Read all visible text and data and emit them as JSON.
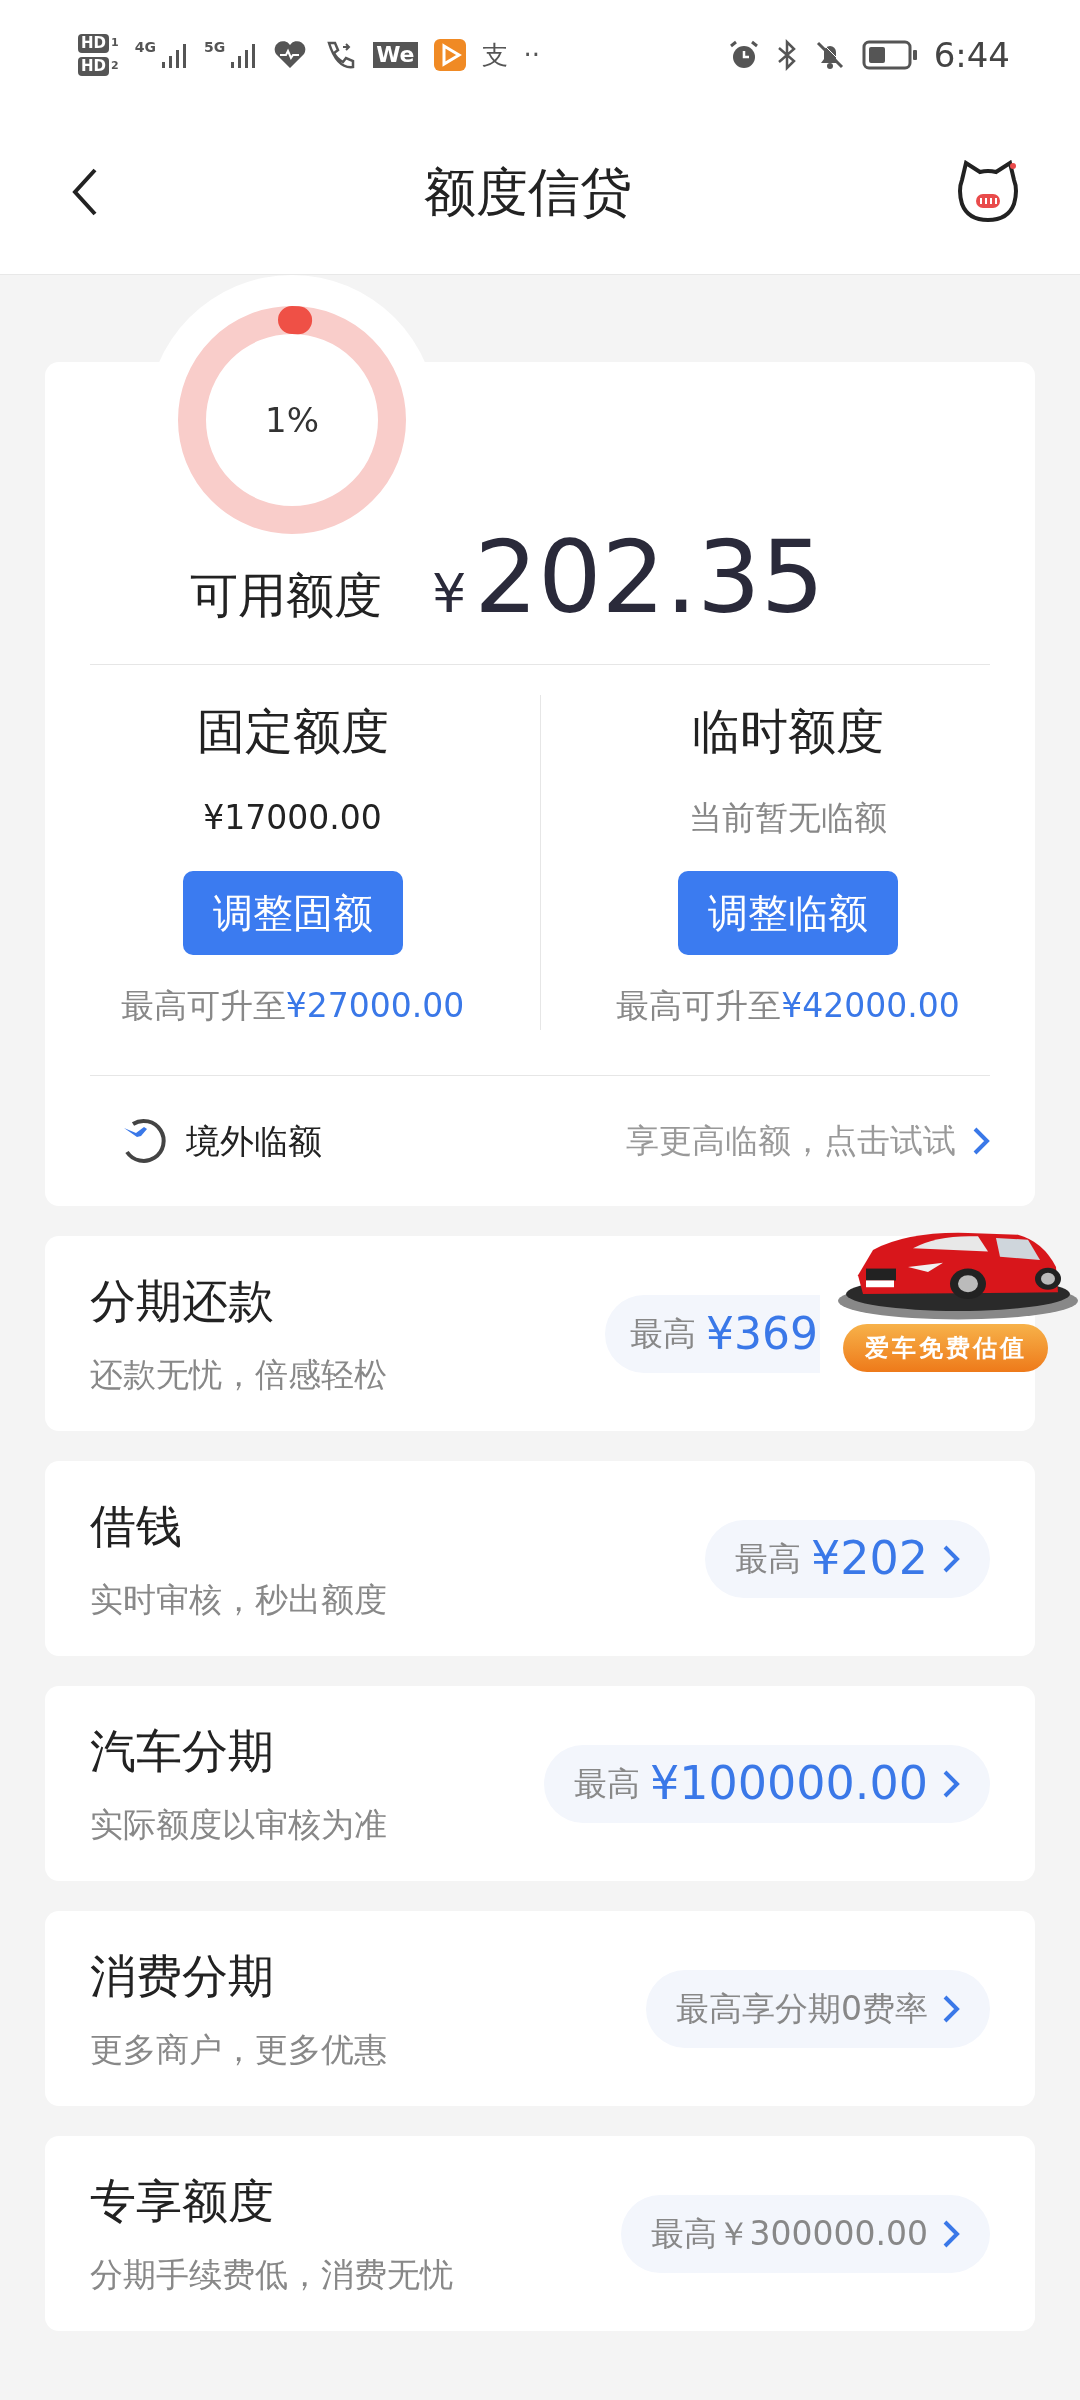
{
  "status_bar": {
    "sim_labels": [
      {
        "badge": "HD",
        "slot": "1"
      },
      {
        "badge": "HD",
        "slot": "2"
      }
    ],
    "networks": [
      "4G",
      "5G"
    ],
    "app_badge": "We",
    "alipay_glyph": "支",
    "more": "··",
    "time": "6:44"
  },
  "header": {
    "title": "额度信贷"
  },
  "credit": {
    "progress_label": "1%",
    "level": 0.01,
    "available_label": "可用额度",
    "currency": "¥",
    "amount": "202.35",
    "columns": [
      {
        "title": "固定额度",
        "value": "¥17000.00",
        "muted": false,
        "button": "调整固额",
        "limit_prefix": "最高可升至",
        "limit_amount": "¥27000.00"
      },
      {
        "title": "临时额度",
        "value": "当前暂无临额",
        "muted": true,
        "button": "调整临额",
        "limit_prefix": "最高可升至",
        "limit_amount": "¥42000.00"
      }
    ],
    "overseas": {
      "label": "境外临额",
      "hint": "享更高临额，点击试试"
    }
  },
  "products": [
    {
      "title": "分期还款",
      "subtitle": "还款无忧，倍感轻松",
      "kind": "amount",
      "chip_label": "最高",
      "chip_amount": "¥369",
      "promo": {
        "kind": "picture",
        "button": "爱车免费估值"
      }
    },
    {
      "title": "借钱",
      "subtitle": "实时审核，秒出额度",
      "kind": "amount",
      "chip_label": "最高",
      "chip_amount": "¥202"
    },
    {
      "title": "汽车分期",
      "subtitle": "实际额度以审核为准",
      "kind": "amount",
      "chip_label": "最高",
      "chip_amount": "¥100000.00"
    },
    {
      "title": "消费分期",
      "subtitle": "更多商户，更多优惠",
      "kind": "text",
      "chip_label": "最高享分期0费率"
    },
    {
      "title": "专享额度",
      "subtitle": "分期手续费低，消费无忧",
      "kind": "text",
      "chip_label": "最高￥300000.00"
    }
  ]
}
